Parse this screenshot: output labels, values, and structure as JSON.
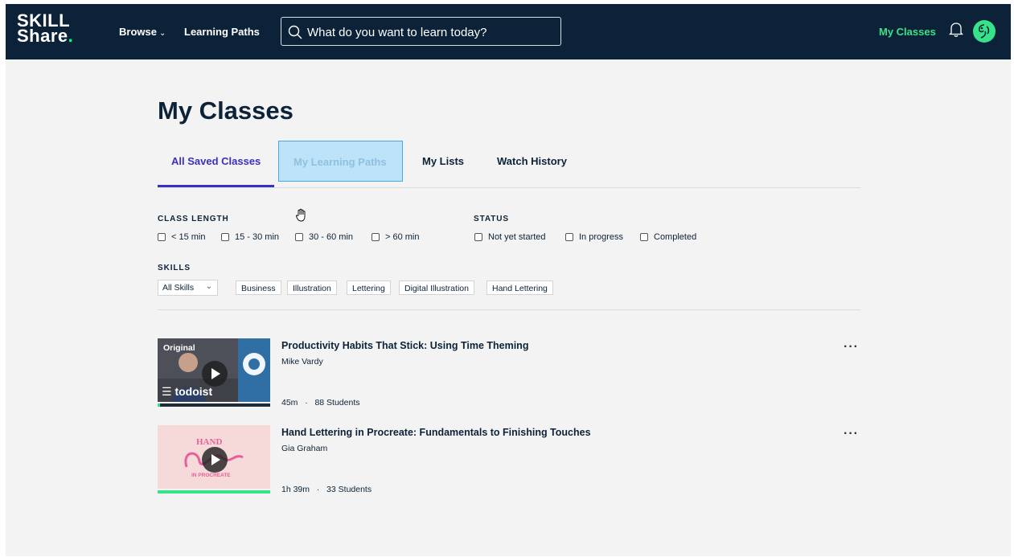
{
  "header": {
    "logo_line1": "SKILL",
    "logo_line2": "Share",
    "logo_dot": ".",
    "browse_label": "Browse",
    "learning_paths_label": "Learning Paths",
    "search_placeholder": "What do you want to learn today?",
    "my_classes_label": "My Classes"
  },
  "page": {
    "title": "My Classes",
    "tabs": [
      {
        "label": "All Saved Classes",
        "active": true
      },
      {
        "label": "My Learning Paths",
        "active": false
      },
      {
        "label": "My Lists",
        "active": false
      },
      {
        "label": "Watch History",
        "active": false
      }
    ]
  },
  "filters": {
    "class_length_label": "CLASS LENGTH",
    "class_length_options": [
      "< 15 min",
      "15 - 30 min",
      "30 - 60 min",
      "> 60 min"
    ],
    "status_label": "STATUS",
    "status_options": [
      "Not yet started",
      "In progress",
      "Completed"
    ],
    "skills_label": "SKILLS",
    "skills_selected": "All Skills",
    "skill_chips": [
      "Business",
      "Illustration",
      "Lettering",
      "Digital Illustration",
      "Hand Lettering"
    ]
  },
  "classes": [
    {
      "title": "Productivity Habits That Stick: Using Time Theming",
      "teacher": "Mike Vardy",
      "duration": "45m",
      "students": "88 Students",
      "badge": "Original",
      "brand": "todoist",
      "progress": 0.02
    },
    {
      "title": "Hand Lettering in Procreate: Fundamentals to Finishing Touches",
      "teacher": "Gia Graham",
      "duration": "1h 39m",
      "students": "33 Students",
      "progress": 1.0
    }
  ],
  "colors": {
    "header_bg": "#0c2238",
    "accent_green": "#38e288",
    "active_tab": "#3a2fbf",
    "page_bg": "#f3f3f3"
  }
}
